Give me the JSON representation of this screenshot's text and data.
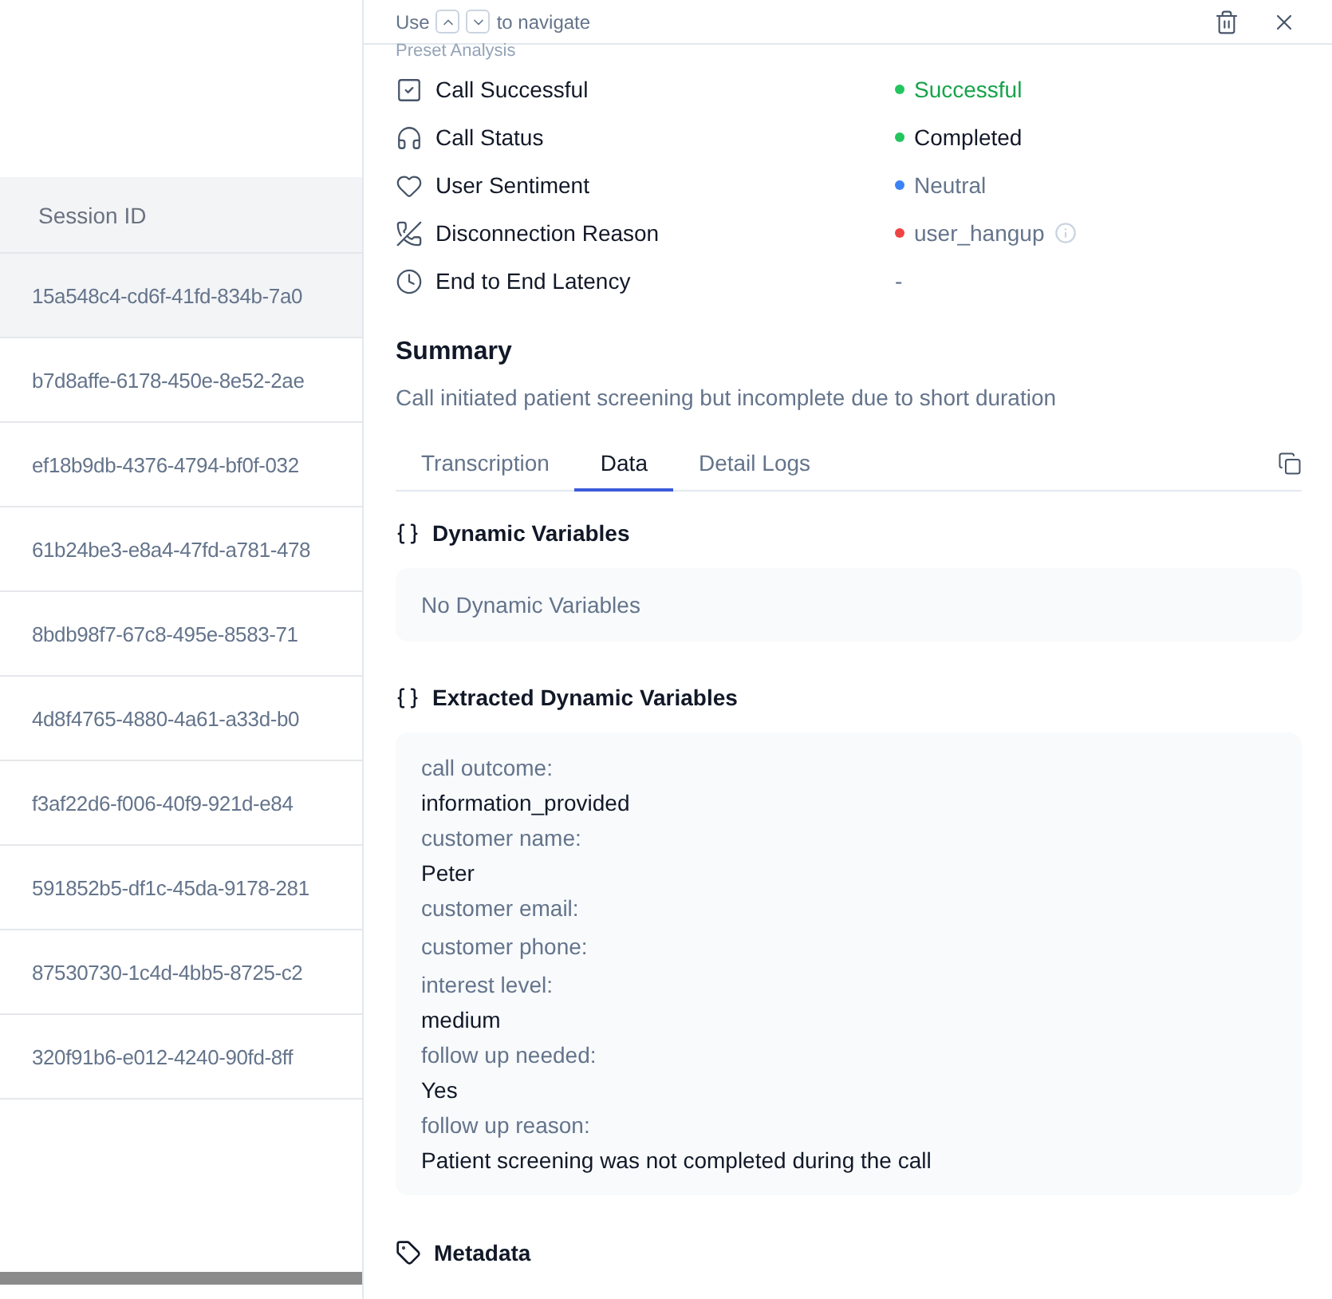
{
  "table": {
    "columns": [
      "Session ID"
    ],
    "rows": [
      {
        "session_id": "15a548c4-cd6f-41fd-834b-7a0",
        "selected": true
      },
      {
        "session_id": "b7d8affe-6178-450e-8e52-2ae",
        "selected": false
      },
      {
        "session_id": "ef18b9db-4376-4794-bf0f-032",
        "selected": false
      },
      {
        "session_id": "61b24be3-e8a4-47fd-a781-478",
        "selected": false
      },
      {
        "session_id": "8bdb98f7-67c8-495e-8583-71",
        "selected": false
      },
      {
        "session_id": "4d8f4765-4880-4a61-a33d-b0",
        "selected": false
      },
      {
        "session_id": "f3af22d6-f006-40f9-921d-e84",
        "selected": false
      },
      {
        "session_id": "591852b5-df1c-45da-9178-281",
        "selected": false
      },
      {
        "session_id": "87530730-1c4d-4bb5-8725-c2",
        "selected": false
      },
      {
        "session_id": "320f91b6-e012-4240-90fd-8ff",
        "selected": false
      }
    ]
  },
  "panel": {
    "hint": [
      "Use",
      "to navigate"
    ],
    "preset_title": "Preset Analysis",
    "preset": [
      {
        "kind": "check",
        "label": "Call Successful",
        "value": "Successful",
        "color": "#22c55e",
        "highlighted": true,
        "muted": false,
        "info": false
      },
      {
        "kind": "headphones",
        "label": "Call Status",
        "value": "Completed",
        "color": "#22c55e",
        "highlighted": false,
        "muted": false,
        "info": false
      },
      {
        "kind": "heart",
        "label": "User Sentiment",
        "value": "Neutral",
        "color": "#3b82f6",
        "highlighted": false,
        "muted": true,
        "info": false
      },
      {
        "kind": "phone",
        "label": "Disconnection Reason",
        "value": "user_hangup",
        "color": "#ef4444",
        "highlighted": false,
        "muted": true,
        "info": true
      },
      {
        "kind": "clock",
        "label": "End to End Latency",
        "value": "-",
        "highlighted": false,
        "muted": true,
        "info": false
      }
    ],
    "summary_title": "Summary",
    "summary": "Call initiated patient screening but incomplete due to short duration",
    "tabs": [
      {
        "label": "Transcription",
        "selected": false
      },
      {
        "label": "Data",
        "selected": true
      },
      {
        "label": "Detail Logs",
        "selected": false
      }
    ],
    "dynamic_title": "Dynamic Variables",
    "dynamic_empty": "No Dynamic Variables",
    "extracted_title": "Extracted Dynamic Variables",
    "extracted": [
      {
        "key": "call outcome:",
        "value": "information_provided"
      },
      {
        "key": "customer name:",
        "value": "Peter"
      },
      {
        "key": "customer email:"
      },
      {
        "key": "customer phone:"
      },
      {
        "key": "interest level:",
        "value": "medium"
      },
      {
        "key": "follow up needed:",
        "value": "Yes"
      },
      {
        "key": "follow up reason:",
        "value": "Patient screening was not completed during the call"
      }
    ],
    "metadata_title": "Metadata"
  }
}
